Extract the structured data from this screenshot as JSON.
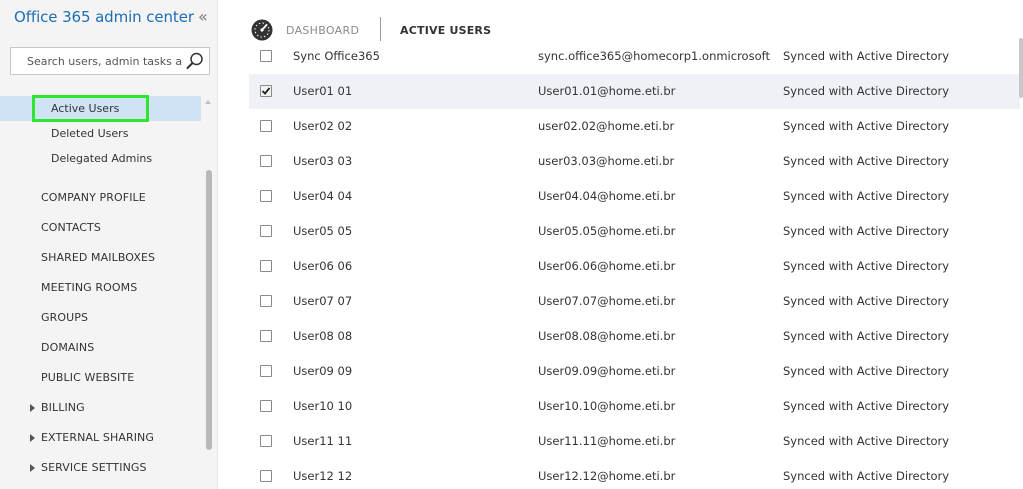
{
  "sidebar": {
    "title": "Office 365 admin center",
    "collapse_icon": "double-chevron-left-icon",
    "search": {
      "placeholder": "Search users, admin tasks an",
      "value": "",
      "icon": "search-icon"
    },
    "sub_items": [
      {
        "label": "Active Users",
        "active": true
      },
      {
        "label": "Deleted Users",
        "active": false
      },
      {
        "label": "Delegated Admins",
        "active": false
      }
    ],
    "items": [
      {
        "label": "COMPANY PROFILE",
        "expandable": false
      },
      {
        "label": "CONTACTS",
        "expandable": false
      },
      {
        "label": "SHARED MAILBOXES",
        "expandable": false
      },
      {
        "label": "MEETING ROOMS",
        "expandable": false
      },
      {
        "label": "GROUPS",
        "expandable": false
      },
      {
        "label": "DOMAINS",
        "expandable": false
      },
      {
        "label": "PUBLIC WEBSITE",
        "expandable": false
      },
      {
        "label": "BILLING",
        "expandable": true
      },
      {
        "label": "EXTERNAL SHARING",
        "expandable": true
      },
      {
        "label": "SERVICE SETTINGS",
        "expandable": true
      }
    ],
    "highlight_color": "#2ee62e",
    "accent": "#1f6db5"
  },
  "header": {
    "dashboard_icon": "speedometer-icon",
    "dashboard_label": "DASHBOARD",
    "active_label": "ACTIVE USERS"
  },
  "users": [
    {
      "name": "Sync Office365",
      "email": "sync.office365@homecorp1.onmicrosoft....",
      "status": "Synced with Active Directory",
      "checked": false
    },
    {
      "name": "User01 01",
      "email": "User01.01@home.eti.br",
      "status": "Synced with Active Directory",
      "checked": true
    },
    {
      "name": "User02 02",
      "email": "user02.02@home.eti.br",
      "status": "Synced with Active Directory",
      "checked": false
    },
    {
      "name": "User03 03",
      "email": "user03.03@home.eti.br",
      "status": "Synced with Active Directory",
      "checked": false
    },
    {
      "name": "User04 04",
      "email": "User04.04@home.eti.br",
      "status": "Synced with Active Directory",
      "checked": false
    },
    {
      "name": "User05 05",
      "email": "User05.05@home.eti.br",
      "status": "Synced with Active Directory",
      "checked": false
    },
    {
      "name": "User06 06",
      "email": "User06.06@home.eti.br",
      "status": "Synced with Active Directory",
      "checked": false
    },
    {
      "name": "User07 07",
      "email": "User07.07@home.eti.br",
      "status": "Synced with Active Directory",
      "checked": false
    },
    {
      "name": "User08 08",
      "email": "User08.08@home.eti.br",
      "status": "Synced with Active Directory",
      "checked": false
    },
    {
      "name": "User09 09",
      "email": "User09.09@home.eti.br",
      "status": "Synced with Active Directory",
      "checked": false
    },
    {
      "name": "User10 10",
      "email": "User10.10@home.eti.br",
      "status": "Synced with Active Directory",
      "checked": false
    },
    {
      "name": "User11 11",
      "email": "User11.11@home.eti.br",
      "status": "Synced with Active Directory",
      "checked": false
    },
    {
      "name": "User12 12",
      "email": "User12.12@home.eti.br",
      "status": "Synced with Active Directory",
      "checked": false
    }
  ]
}
